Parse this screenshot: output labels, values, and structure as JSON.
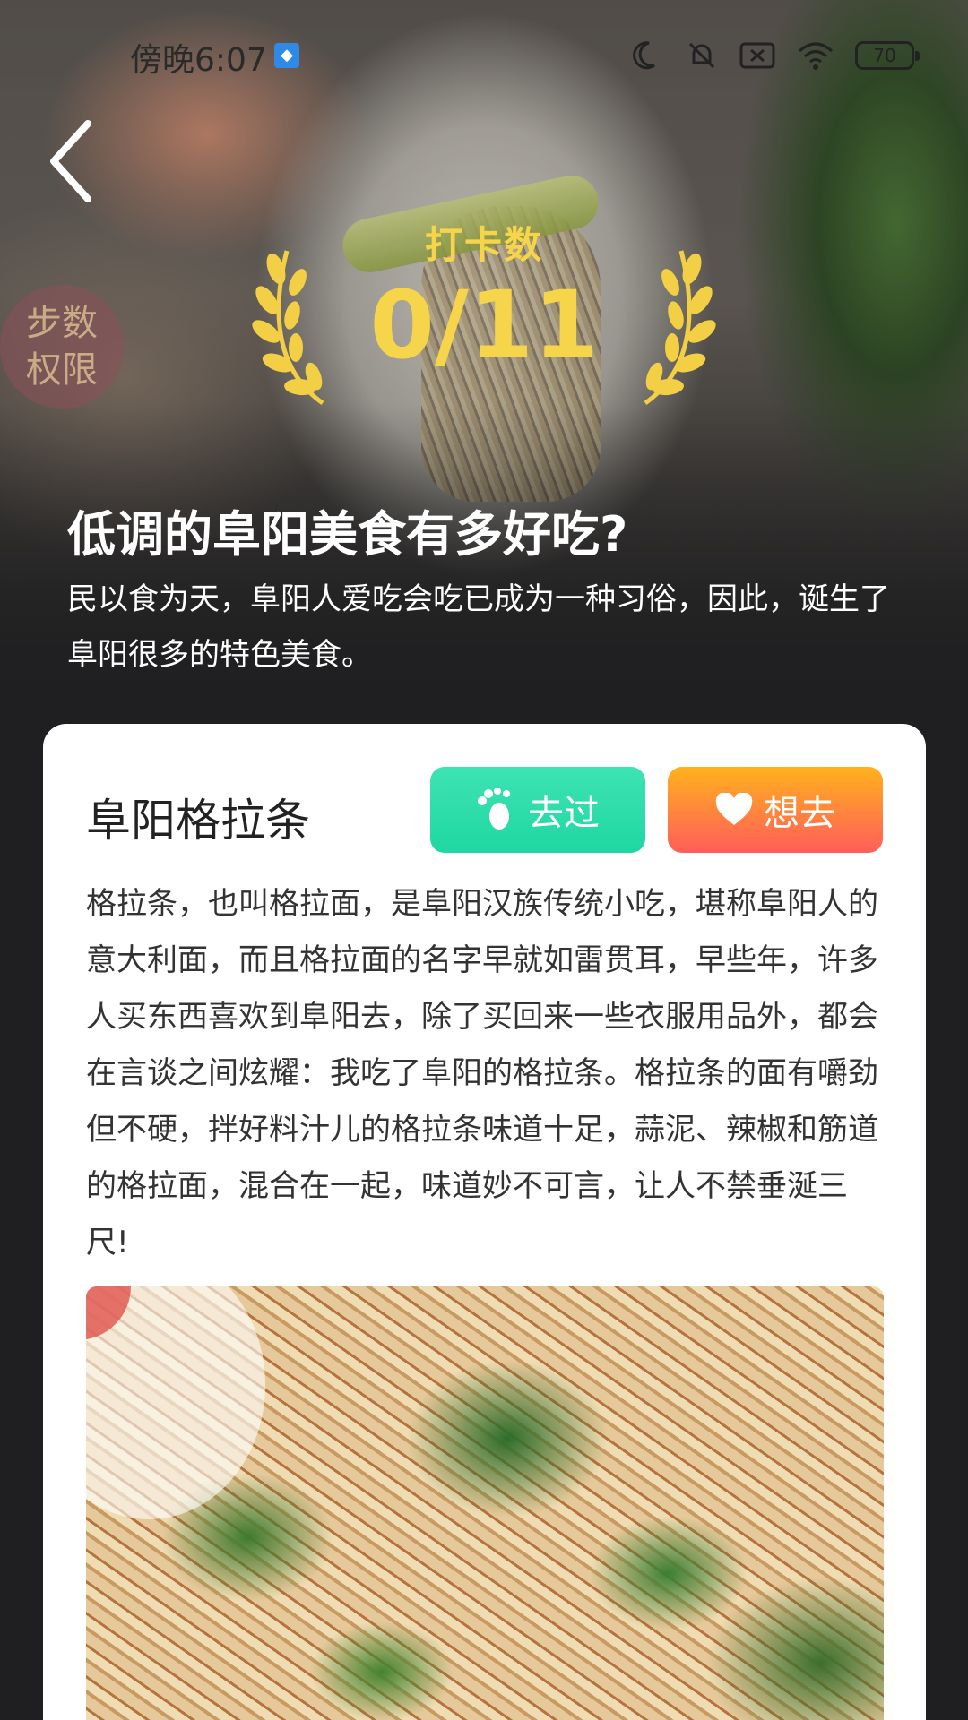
{
  "status_bar": {
    "time": "傍晚6:07",
    "battery": "70"
  },
  "hero": {
    "permission_badge": [
      "步数",
      "权限"
    ],
    "checkin_label": "打卡数",
    "checkin_count": "0/11",
    "title": "低调的阜阳美食有多好吃?",
    "description": "民以食为天，阜阳人爱吃会吃已成为一种习俗，因此，诞生了阜阳很多的特色美食。"
  },
  "card": {
    "name": "阜阳格拉条",
    "been_label": "去过",
    "want_label": "想去",
    "description": "格拉条，也叫格拉面，是阜阳汉族传统小吃，堪称阜阳人的意大利面，而且格拉面的名字早就如雷贯耳，早些年，许多人买东西喜欢到阜阳去，除了买回来一些衣服用品外，都会在言谈之间炫耀：我吃了阜阳的格拉条。格拉条的面有嚼劲但不硬，拌好料汁儿的格拉条味道十足，蒜泥、辣椒和筋道的格拉面，混合在一起，味道妙不可言，让人不禁垂涎三尺!"
  },
  "colors": {
    "accent_gold": "#f7d54a",
    "been_green": "#1fd7a2",
    "want_orange": "#ffb21d",
    "want_red": "#ff5d5a"
  },
  "icons": {
    "back": "chevron-left-icon",
    "been": "footprint-icon",
    "want": "heart-icon"
  }
}
